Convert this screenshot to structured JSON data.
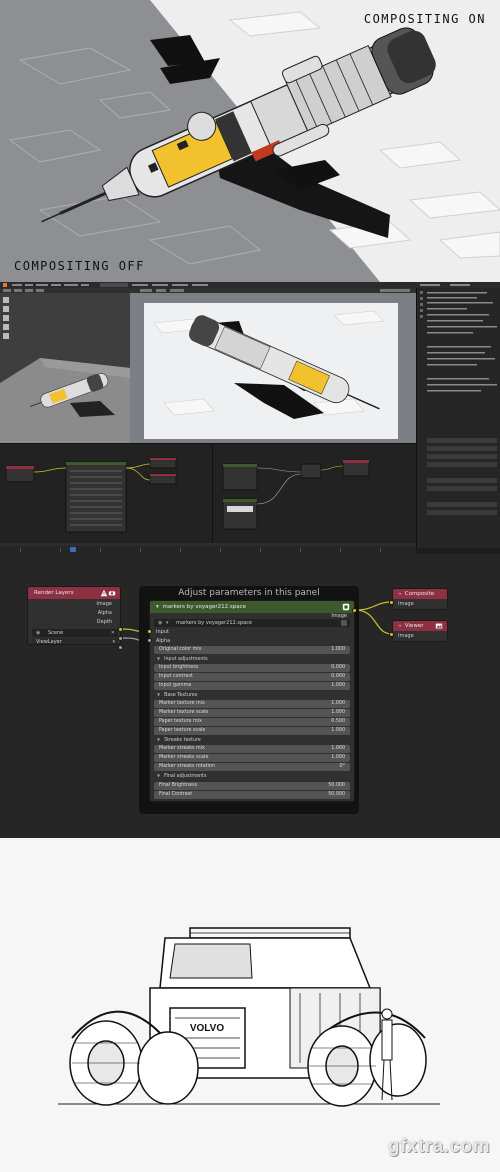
{
  "compositing": {
    "label_on": "COMPOSITING ON",
    "label_off": "COMPOSITING OFF"
  },
  "node_editor": {
    "frame_title": "Adjust parameters in this panel",
    "render_layers": {
      "title": "Render Layers",
      "outputs": [
        "Image",
        "Alpha",
        "Depth"
      ],
      "scene": "Scene",
      "view_layer": "ViewLayer"
    },
    "group_node": {
      "title": "markers by voyager212.space",
      "output": "Image",
      "datablock": "markers by voyager212.space",
      "inputs": [
        "Input",
        "Alpha"
      ],
      "rows": [
        {
          "type": "param",
          "label": "Original color mix",
          "value": "1.000"
        },
        {
          "type": "section",
          "label": "Input adjustments"
        },
        {
          "type": "param",
          "label": "Input brightness",
          "value": "0.000"
        },
        {
          "type": "param",
          "label": "Input contrast",
          "value": "0.000"
        },
        {
          "type": "param",
          "label": "Input gamma",
          "value": "1.000"
        },
        {
          "type": "section",
          "label": "Base Textures"
        },
        {
          "type": "param",
          "label": "Marker texture mix",
          "value": "1.000"
        },
        {
          "type": "param",
          "label": "Marker texture scale",
          "value": "1.000"
        },
        {
          "type": "param",
          "label": "Paper texture mix",
          "value": "0.500"
        },
        {
          "type": "param",
          "label": "Paper texture scale",
          "value": "1.000"
        },
        {
          "type": "section",
          "label": "Streaks texture"
        },
        {
          "type": "param",
          "label": "Marker streaks mix",
          "value": "1.000"
        },
        {
          "type": "param",
          "label": "Marker streaks scale",
          "value": "1.000"
        },
        {
          "type": "param",
          "label": "Marker streaks rotation",
          "value": "0°"
        },
        {
          "type": "section",
          "label": "Final adjustments"
        },
        {
          "type": "param",
          "label": "Final Brightness",
          "value": "50.000"
        },
        {
          "type": "param",
          "label": "Final Contrast",
          "value": "50.000"
        }
      ]
    },
    "composite": {
      "title": "Composite",
      "input": "Image"
    },
    "viewer": {
      "title": "Viewer",
      "input": "Image"
    }
  },
  "lineart": {
    "grille_text": "VOLVO"
  },
  "watermark": "gfxtra.com",
  "colors": {
    "node_red_header": "#8d3142",
    "node_green_header": "#3c5a2c",
    "socket_yellow": "#c7c729",
    "socket_gray": "#a1a1a1",
    "ship_yellow": "#f2c12e"
  }
}
